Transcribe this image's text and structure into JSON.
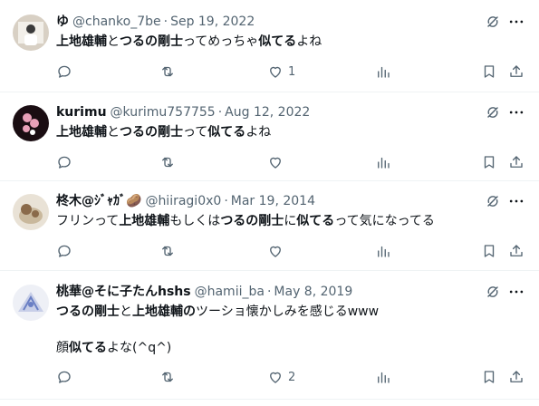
{
  "tweets": [
    {
      "name": "ゆ",
      "handle": "@chanko_7be",
      "date": "Sep 19, 2022",
      "lines": [
        [
          {
            "t": "上地雄輔",
            "b": true
          },
          {
            "t": "と",
            "b": false
          },
          {
            "t": "つるの剛士",
            "b": true
          },
          {
            "t": "ってめっちゃ",
            "b": false
          },
          {
            "t": "似てる",
            "b": true
          },
          {
            "t": "よね",
            "b": false
          }
        ]
      ],
      "likes": "1",
      "avatar_colors": [
        "#d8d0c4",
        "#3a3a3a",
        "#f2efe9"
      ]
    },
    {
      "name": "kurimu",
      "handle": "@kurimu757755",
      "date": "Aug 12, 2022",
      "lines": [
        [
          {
            "t": "上地雄輔",
            "b": true
          },
          {
            "t": "と",
            "b": false
          },
          {
            "t": "つるの剛士",
            "b": true
          },
          {
            "t": "って",
            "b": false
          },
          {
            "t": "似てる",
            "b": true
          },
          {
            "t": "よね",
            "b": false
          }
        ]
      ],
      "likes": "",
      "avatar_colors": [
        "#1a0d12",
        "#e8a0b8",
        "#ffffff"
      ]
    },
    {
      "name": "柊木@ｼﾞｬｶﾞ🥔",
      "handle": "@hiiragi0x0",
      "date": "Mar 19, 2014",
      "lines": [
        [
          {
            "t": "フリンって",
            "b": false
          },
          {
            "t": "上地雄輔",
            "b": true
          },
          {
            "t": "もしくは",
            "b": false
          },
          {
            "t": "つるの剛士",
            "b": true
          },
          {
            "t": "に",
            "b": false
          },
          {
            "t": "似てる",
            "b": true
          },
          {
            "t": "って気になってる",
            "b": false
          }
        ]
      ],
      "likes": "",
      "avatar_colors": [
        "#e9e2d6",
        "#8a6a4a",
        "#c9b89c"
      ]
    },
    {
      "name": "桃華@そに子たんhshs",
      "handle": "@hamii_ba",
      "date": "May 8, 2019",
      "lines": [
        [
          {
            "t": "つるの剛士",
            "b": true
          },
          {
            "t": "と",
            "b": false
          },
          {
            "t": "上地雄輔の",
            "b": true
          },
          {
            "t": "ツーショ懐かしみを感じるwww",
            "b": false
          }
        ],
        [],
        [
          {
            "t": "顔",
            "b": false
          },
          {
            "t": "似てる",
            "b": true
          },
          {
            "t": "よな(^q^)",
            "b": false
          }
        ]
      ],
      "likes": "2",
      "avatar_colors": [
        "#eef0f6",
        "#6a7fc4",
        "#c8cfe8"
      ]
    }
  ],
  "icons": {
    "grok": "grok-slash-icon",
    "more": "more-dots-icon",
    "reply": "reply-icon",
    "retweet": "retweet-icon",
    "like": "heart-icon",
    "views": "views-chart-icon",
    "bookmark": "bookmark-icon",
    "share": "share-icon"
  },
  "colors": {
    "text": "#0f1419",
    "muted": "#536471",
    "separator": "#eff3f4"
  }
}
